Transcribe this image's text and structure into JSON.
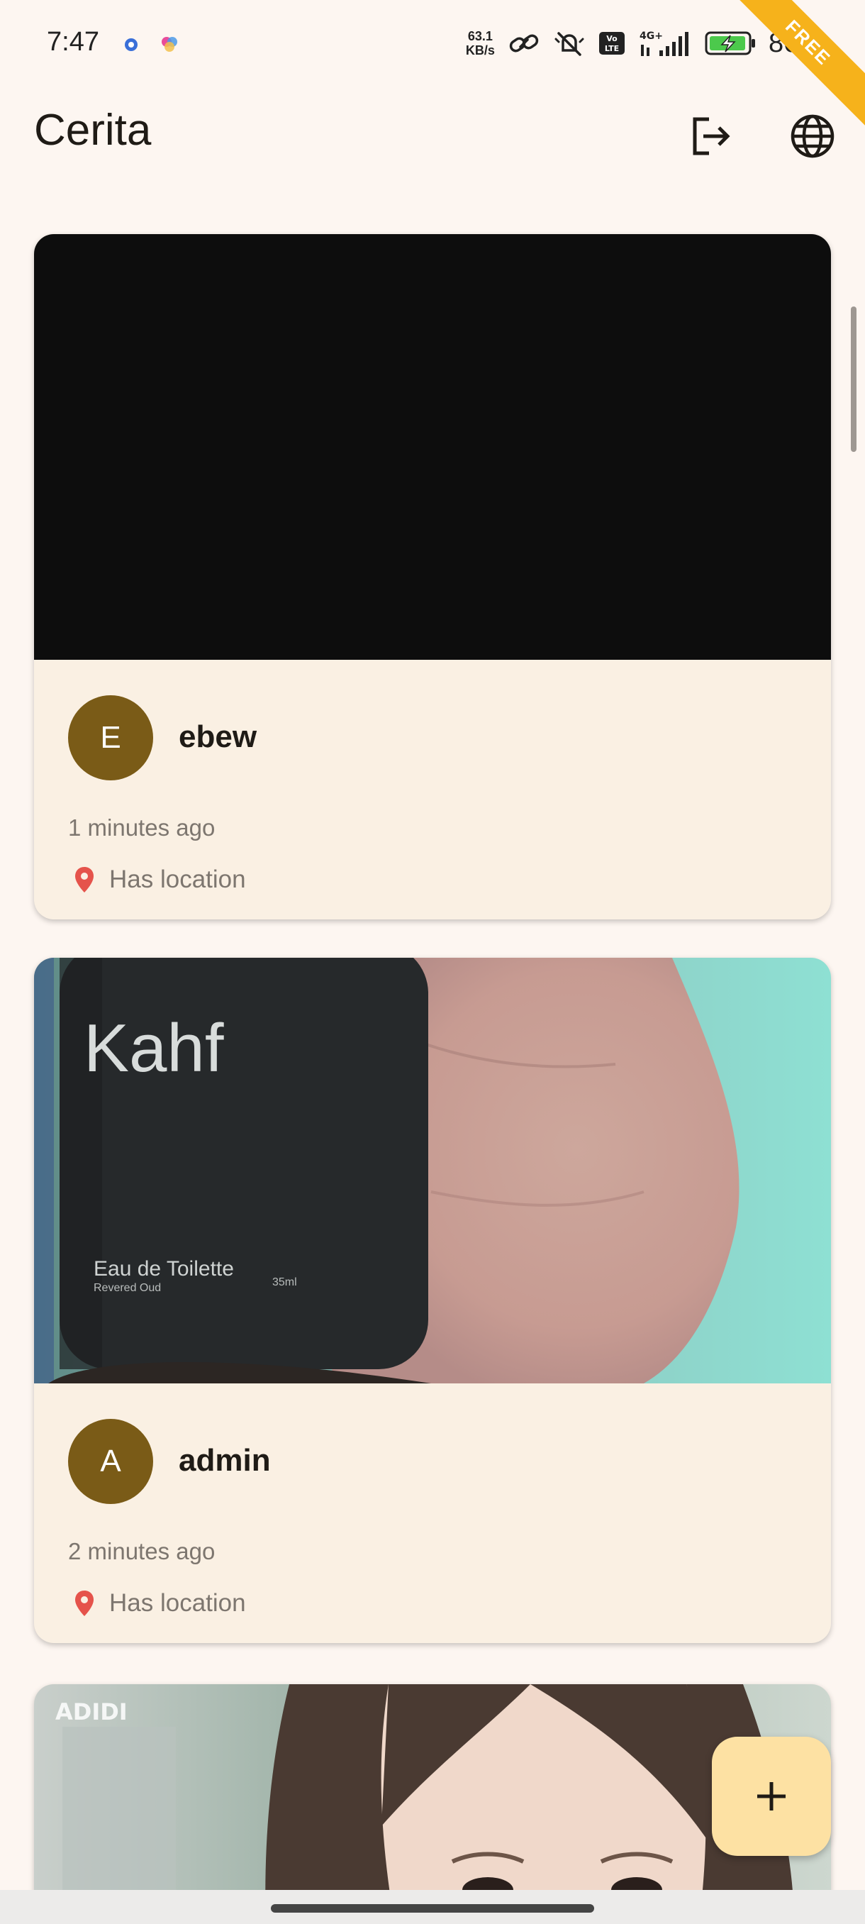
{
  "status_bar": {
    "time": "7:47",
    "net_speed_value": "63.1",
    "net_speed_unit": "KB/s",
    "network": "4G+",
    "battery": "86%",
    "ribbon": "FREE"
  },
  "app_bar": {
    "title": "Cerita",
    "logout_icon": "logout-icon",
    "language_icon": "globe-icon"
  },
  "stories": [
    {
      "image": "black photo",
      "avatar_letter": "E",
      "name": "ebew",
      "time": "1 minutes ago",
      "location": "Has location"
    },
    {
      "image": "Kahf Eau de Toilette bottle held in hand",
      "image_text": {
        "brand": "Kahf",
        "product": "Eau de Toilette",
        "variant": "Revered Oud",
        "volume": "35ml"
      },
      "avatar_letter": "A",
      "name": "admin",
      "time": "2 minutes ago",
      "location": "Has location"
    },
    {
      "image": "portrait photo of a woman",
      "image_text": {
        "watermark": "ADIDI"
      }
    }
  ],
  "fab": {
    "icon": "plus-icon"
  },
  "colors": {
    "background": "#fdf6f1",
    "card": "#faf0e3",
    "avatar": "#7a5b17",
    "fab": "#fde1a3",
    "location_pin": "#e5534b"
  }
}
